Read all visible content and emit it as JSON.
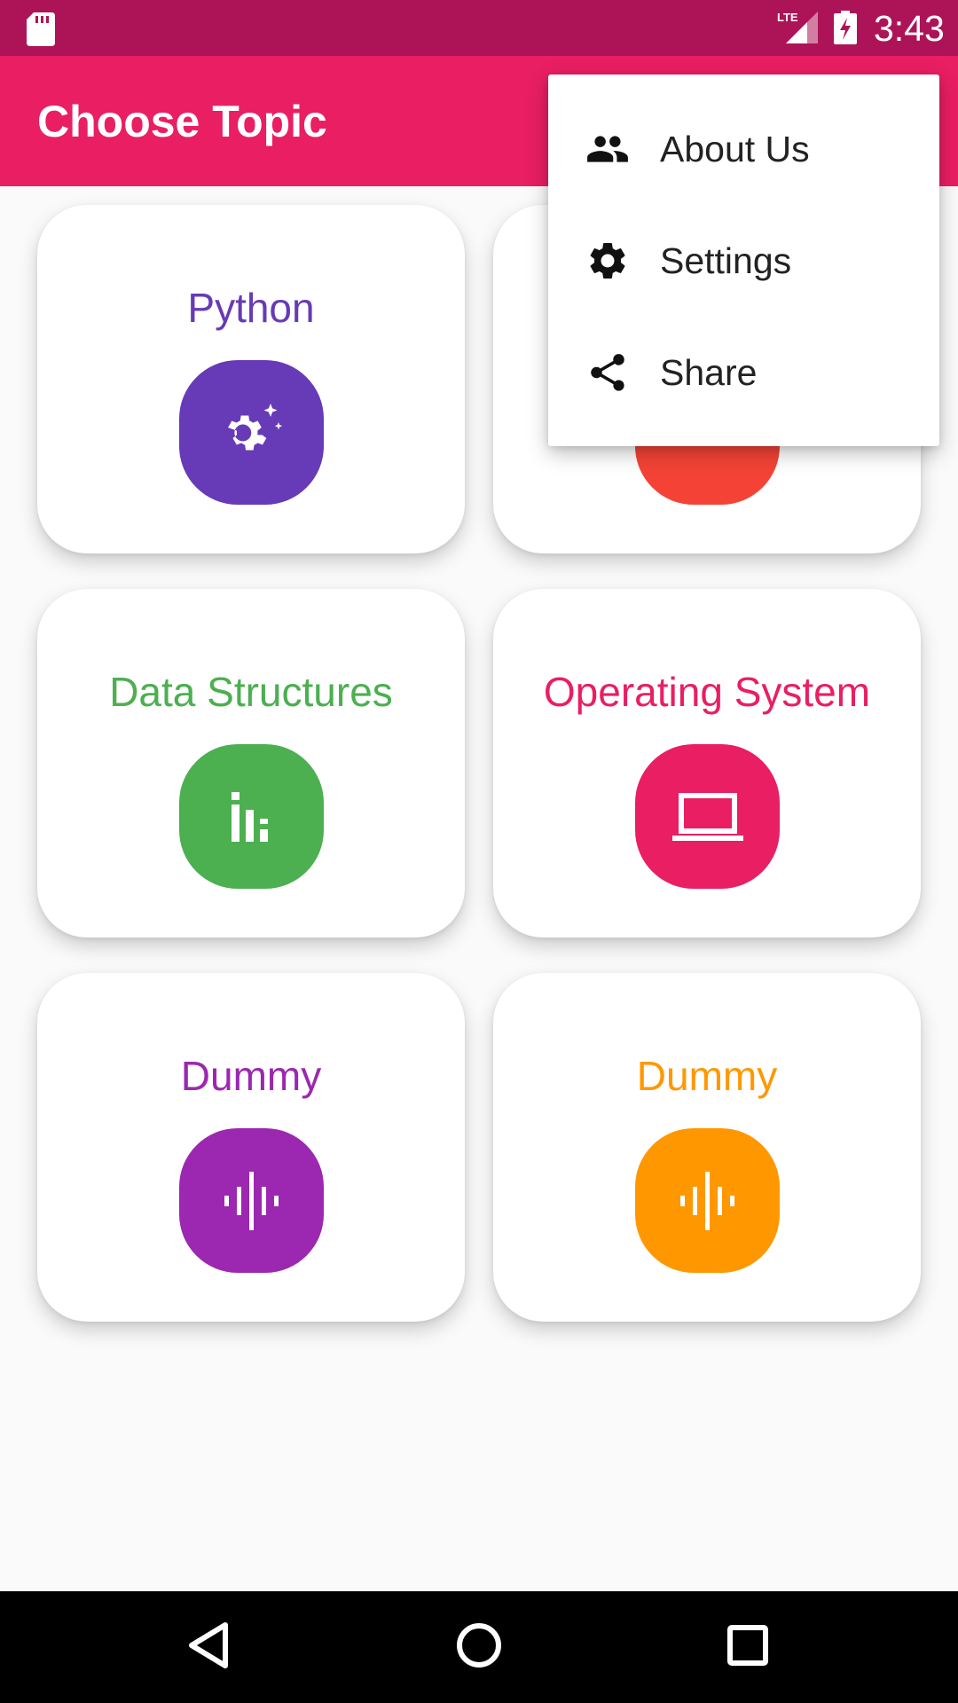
{
  "status_bar": {
    "time": "3:43",
    "network": "LTE",
    "icons": [
      "sd-card-icon",
      "lte-signal-icon",
      "battery-charging-icon"
    ]
  },
  "app_bar": {
    "title": "Choose Topic"
  },
  "topics": [
    {
      "label": "Python",
      "color": "#673ab7",
      "icon": "settings-sparkle-icon"
    },
    {
      "label": "",
      "color": "#f44336",
      "icon": "hidden-icon"
    },
    {
      "label": "Data Structures",
      "color": "#4caf50",
      "icon": "bar-chart-icon"
    },
    {
      "label": "Operating System",
      "color": "#e91e63",
      "icon": "laptop-icon"
    },
    {
      "label": "Dummy",
      "color": "#9c27b0",
      "icon": "audio-waveform-icon"
    },
    {
      "label": "Dummy",
      "color": "#ff9800",
      "icon": "audio-waveform-icon"
    }
  ],
  "overflow_menu": {
    "items": [
      {
        "label": "About Us",
        "icon": "people-icon"
      },
      {
        "label": "Settings",
        "icon": "gear-icon"
      },
      {
        "label": "Share",
        "icon": "share-icon"
      }
    ]
  },
  "colors": {
    "status_bar": "#ad1457",
    "app_bar": "#e91e63",
    "background": "#fafafa"
  },
  "nav_bar": {
    "buttons": [
      "back-icon",
      "home-icon",
      "recents-icon"
    ]
  }
}
